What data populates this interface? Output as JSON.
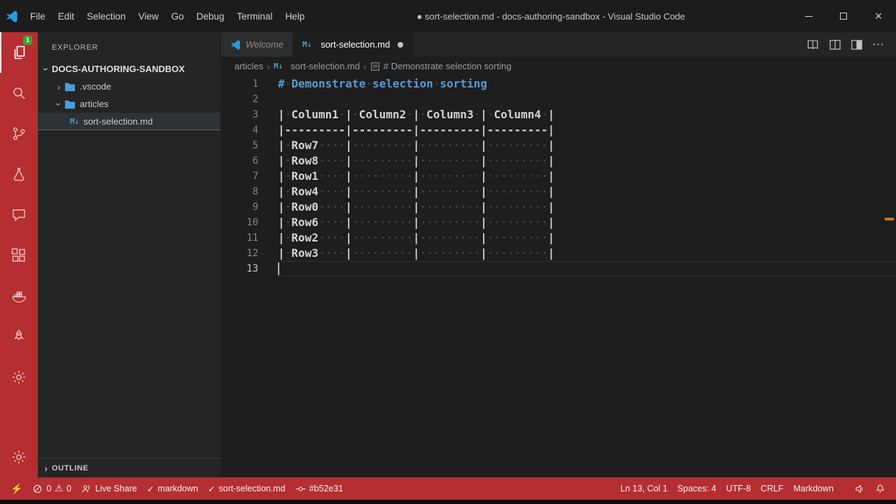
{
  "title_bar": {
    "menus": [
      "File",
      "Edit",
      "Selection",
      "View",
      "Go",
      "Debug",
      "Terminal",
      "Help"
    ],
    "title": "● sort-selection.md - docs-authoring-sandbox - Visual Studio Code"
  },
  "activity_bar": {
    "explorer_badge": "1"
  },
  "sidebar": {
    "header": "EXPLORER",
    "section": "DOCS-AUTHORING-SANDBOX",
    "items": [
      {
        "label": ".vscode"
      },
      {
        "label": "articles"
      },
      {
        "label": "sort-selection.md"
      }
    ],
    "outline_label": "OUTLINE"
  },
  "tabs": [
    {
      "label": "Welcome"
    },
    {
      "label": "sort-selection.md"
    }
  ],
  "breadcrumbs": [
    "articles",
    "sort-selection.md",
    "# Demonstrate selection sorting"
  ],
  "editor": {
    "lines": [
      {
        "n": 1,
        "t": "# Demonstrate selection sorting",
        "heading": true
      },
      {
        "n": 2,
        "t": ""
      },
      {
        "n": 3,
        "t": "| Column1 | Column2 | Column3 | Column4 |"
      },
      {
        "n": 4,
        "t": "|---------|---------|---------|---------|"
      },
      {
        "n": 5,
        "t": "| Row7    |         |         |         |"
      },
      {
        "n": 6,
        "t": "| Row8    |         |         |         |"
      },
      {
        "n": 7,
        "t": "| Row1    |         |         |         |"
      },
      {
        "n": 8,
        "t": "| Row4    |         |         |         |"
      },
      {
        "n": 9,
        "t": "| Row0    |         |         |         |"
      },
      {
        "n": 10,
        "t": "| Row6    |         |         |         |"
      },
      {
        "n": 11,
        "t": "| Row2    |         |         |         |"
      },
      {
        "n": 12,
        "t": "| Row3    |         |         |         |"
      },
      {
        "n": 13,
        "t": "",
        "current": true
      }
    ]
  },
  "status_bar": {
    "errors": "0",
    "warnings": "0",
    "live_share": "Live Share",
    "lint_markdown": "markdown",
    "lint_file": "sort-selection.md",
    "commit": "#b52e31",
    "line_col": "Ln 13, Col 1",
    "indent": "Spaces: 4",
    "encoding": "UTF-8",
    "eol": "CRLF",
    "language": "Markdown"
  },
  "icons": {
    "check": "✓",
    "chevron": "›",
    "more": "⋯",
    "md_glyph": "M↓",
    "close": "×",
    "lightning": "⚡",
    "dirty_dot": "●"
  },
  "colors": {
    "accent_red": "#b52e31",
    "heading_blue": "#569cd6",
    "markdown_icon_blue": "#519aba",
    "modified_marker_orange": "#c27c12"
  }
}
